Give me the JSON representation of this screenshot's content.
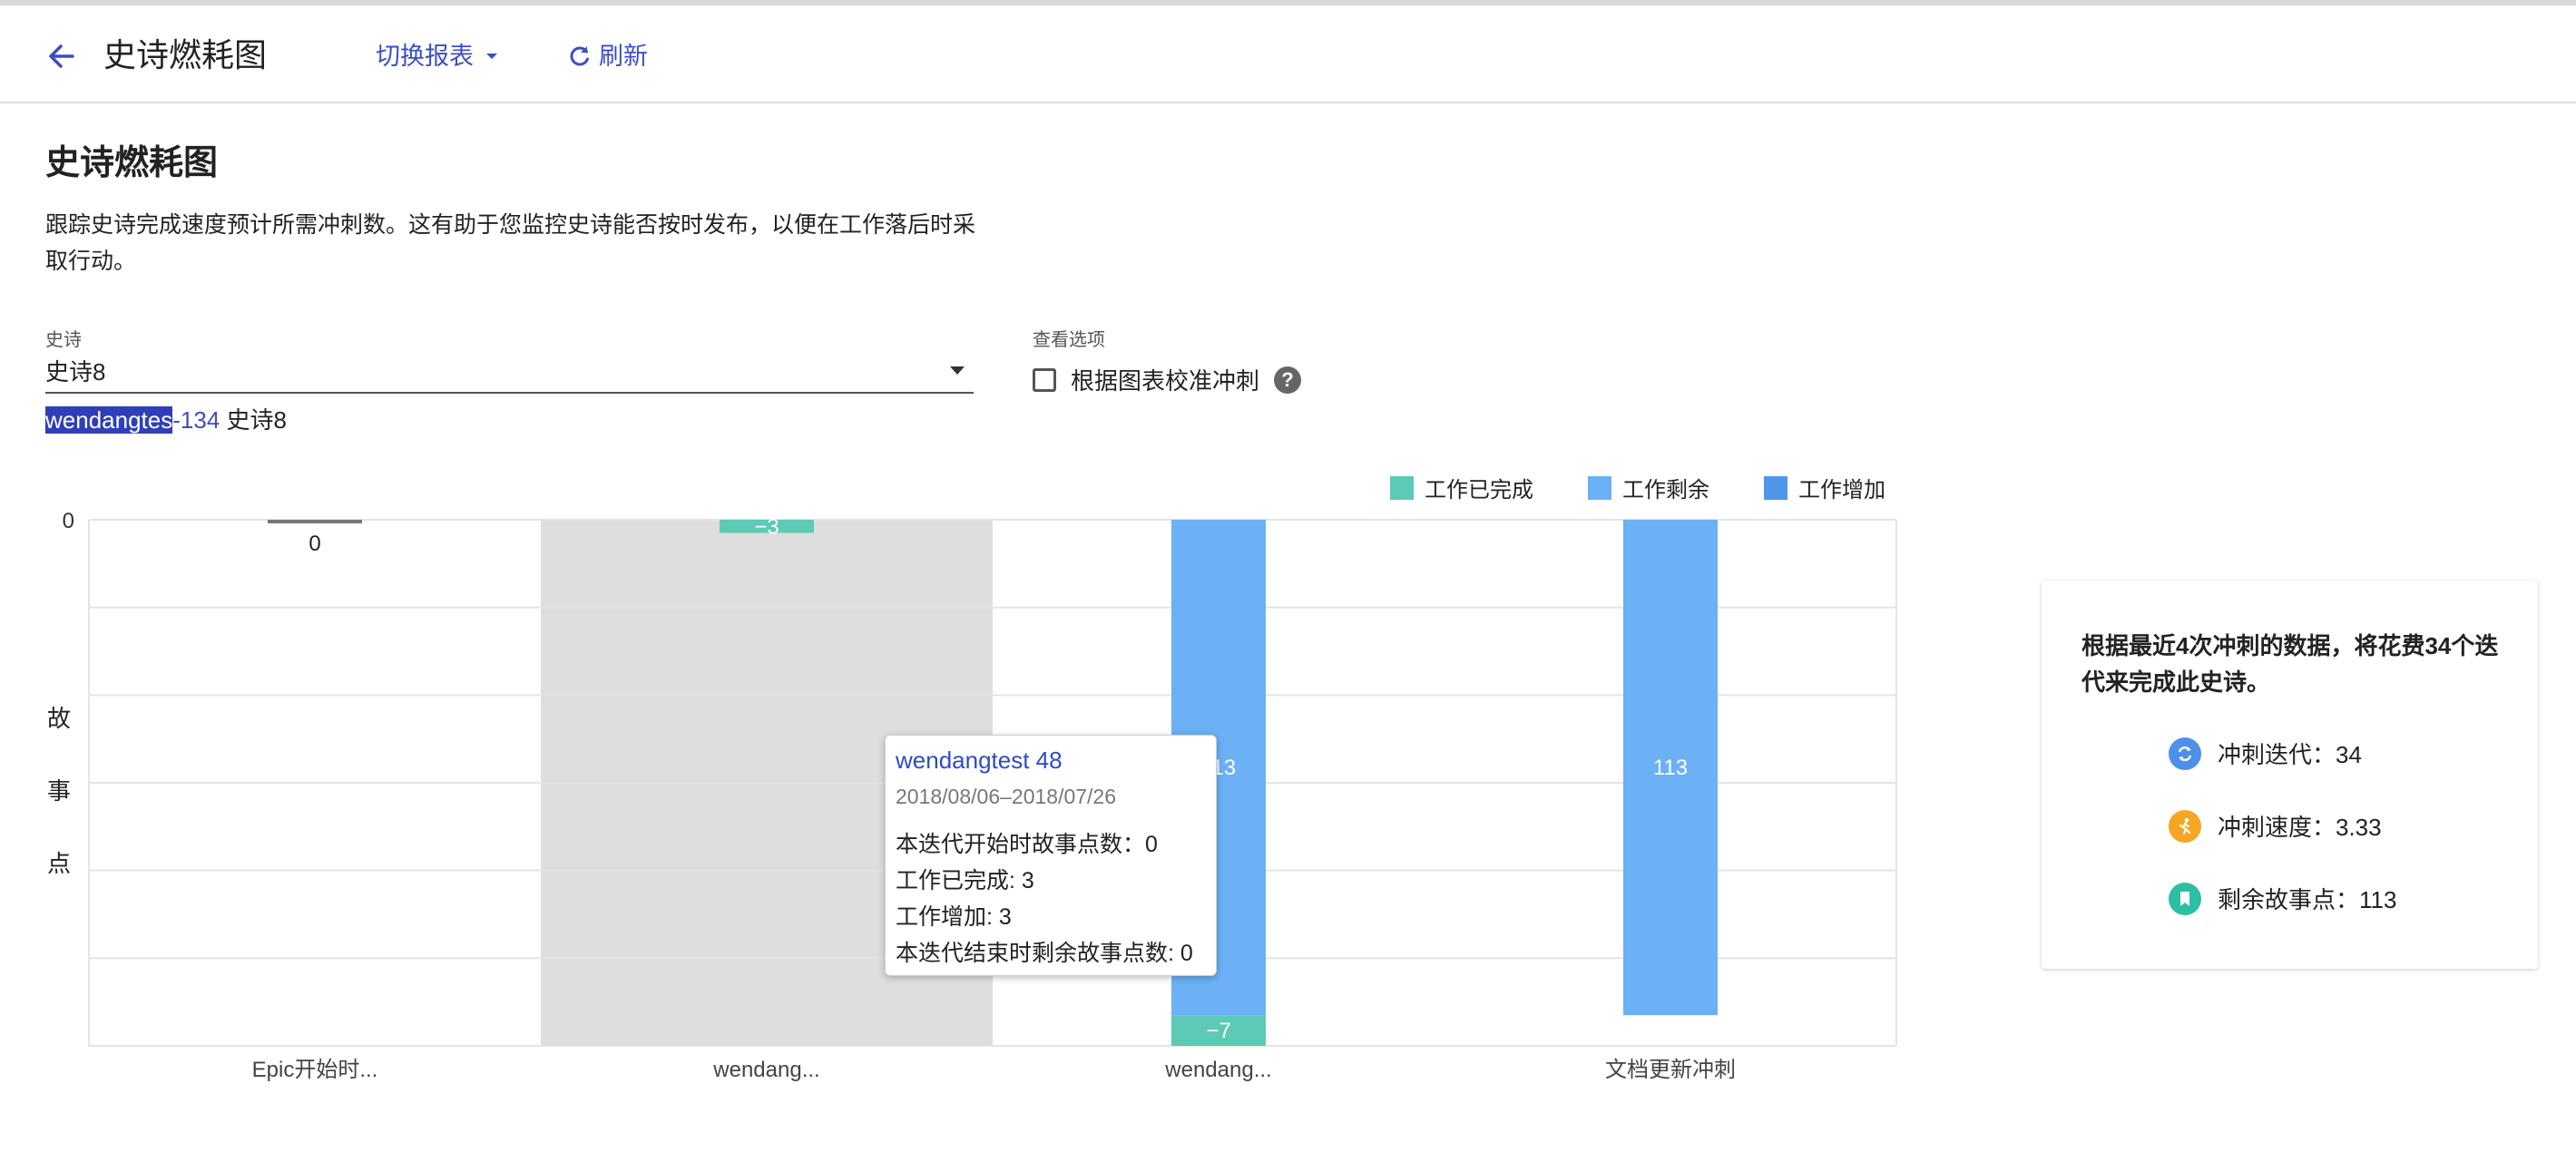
{
  "header": {
    "title": "史诗燃耗图",
    "switch_report": "切换报表",
    "refresh": "刷新"
  },
  "page": {
    "title": "史诗燃耗图",
    "description": "跟踪史诗完成速度预计所需冲刺数。这有助于您监控史诗能否按时发布，以便在工作落后时采取行动。"
  },
  "epic": {
    "label": "史诗",
    "value": "史诗8",
    "link_selected": "wendangtes",
    "link_rest": "-134",
    "link_name": "史诗8"
  },
  "view_options": {
    "label": "查看选项",
    "calibrate": "根据图表校准冲刺",
    "calibrate_checked": false,
    "help": "?"
  },
  "chart_data": {
    "type": "bar",
    "ylabel": "故事点",
    "y_tick": "0",
    "categories": [
      "Epic开始时...",
      "wendang...",
      "wendang...",
      "文档更新冲刺"
    ],
    "legend": [
      {
        "name": "工作已完成",
        "color": "#5ccab5"
      },
      {
        "name": "工作剩余",
        "color": "#6cb0f5"
      },
      {
        "name": "工作增加",
        "color": "#4f96e8"
      }
    ],
    "bars": [
      {
        "category_index": 0,
        "segments": [],
        "label": "0"
      },
      {
        "category_index": 1,
        "segments": [
          {
            "series": "工作已完成",
            "value": 3,
            "label": "−3"
          }
        ]
      },
      {
        "category_index": 2,
        "segments": [
          {
            "series": "工作剩余",
            "value": 113,
            "label": "113"
          },
          {
            "series": "工作已完成",
            "value": 7,
            "label": "−7"
          }
        ]
      },
      {
        "category_index": 3,
        "segments": [
          {
            "series": "工作剩余",
            "value": 113,
            "label": "113"
          }
        ]
      }
    ],
    "highlighted_category_index": 1
  },
  "tooltip": {
    "title": "wendangtest 48",
    "date": "2018/08/06–2018/07/26",
    "start_points": "本迭代开始时故事点数：0",
    "done": "工作已完成: 3",
    "added": "工作增加: 3",
    "end_remaining": "本迭代结束时剩余故事点数: 0"
  },
  "forecast": {
    "text": "根据最近4次冲刺的数据，将花费34个迭代来完成此史诗。",
    "sprints_label": "冲刺迭代：34",
    "velocity_label": "冲刺速度：3.33",
    "remaining_label": "剩余故事点：113",
    "colors": {
      "sprints": "#4f8fe8",
      "velocity": "#f5a623",
      "remaining": "#2bbfa4"
    }
  }
}
